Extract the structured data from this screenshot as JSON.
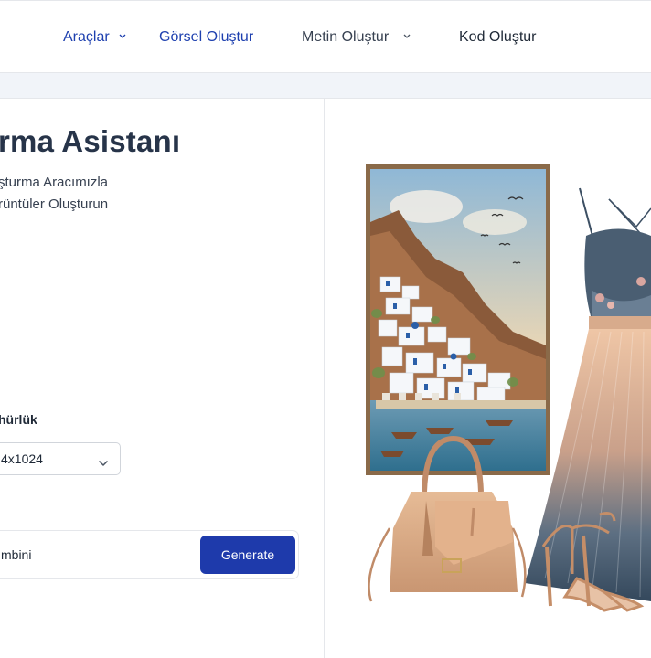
{
  "nav": {
    "items": [
      {
        "label": "Araçlar",
        "has_dropdown": true
      },
      {
        "label": "Görsel Oluştur",
        "has_dropdown": false
      },
      {
        "label": "Metin Oluştur",
        "has_dropdown": true
      },
      {
        "label": "Kod Oluştur",
        "has_dropdown": false
      }
    ]
  },
  "hero": {
    "title": "rma Asistanı",
    "subtitle_line1": "ştur​ma Aracımızla",
    "subtitle_line2": "rüntüler Oluşturun"
  },
  "form": {
    "resolution_label": "hürlük",
    "resolution_value": "4x1024",
    "prompt_value": "mbini",
    "generate_label": "Generate"
  },
  "colors": {
    "accent": "#1e3aab",
    "nav_active": "#1e40af"
  }
}
